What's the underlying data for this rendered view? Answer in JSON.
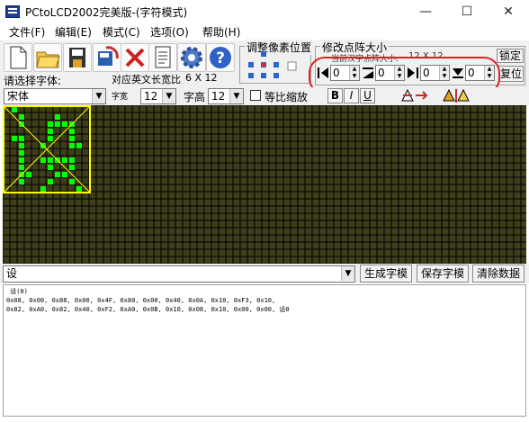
{
  "window": {
    "title": "PCtoLCD2002完美版-(字符模式)",
    "minimize": "—",
    "maximize": "☐",
    "close": "✕"
  },
  "menu": [
    "文件(F)",
    "编辑(E)",
    "模式(C)",
    "选项(O)",
    "帮助(H)"
  ],
  "toolbar": {
    "adjust_group_title": "调整像素位置",
    "resize_group_title": "修改点阵大小",
    "dot_size_label": "当前汉字点阵大小:",
    "dot_size_value": "12 X 12",
    "lock_label": "锁定",
    "reset_label": "复位",
    "spin_left": "0",
    "spin_top": "0",
    "spin_right": "0",
    "spin_bottom": "0"
  },
  "controls": {
    "font_prompt": "请选择字体:",
    "width_label": "对应英文长宽比",
    "width_value": "6 X 12",
    "font_value": "宋体",
    "char_width_label": "字宽",
    "char_width_value": "12",
    "char_height_label": "字高",
    "char_height_value": "12",
    "proportional_label": "等比缩放",
    "bold": "B",
    "italic": "I",
    "underline": "U"
  },
  "input_row": {
    "text_value": "设",
    "generate_btn": "生成字模",
    "save_btn": "保存字模",
    "clear_btn": "清除数据"
  },
  "output": {
    "lines": [
      " 设(0)",
      "",
      "0x08, 0x00, 0x88, 0x00, 0x4F, 0x80, 0x00, 0x40, 0x0A, 0x10, 0xF3, 0x10,",
      "0x82, 0xA0, 0x82, 0x40, 0xF2, 0xA0, 0x0B, 0x10, 0x08, 0x10, 0x00, 0x00, 设0"
    ]
  },
  "colors": {
    "grid_bg": "#3e3e1b",
    "grid_line": "#000000",
    "pixel_on": "#00ff00",
    "selection": "#ffff00",
    "annotation": "#e02020"
  }
}
